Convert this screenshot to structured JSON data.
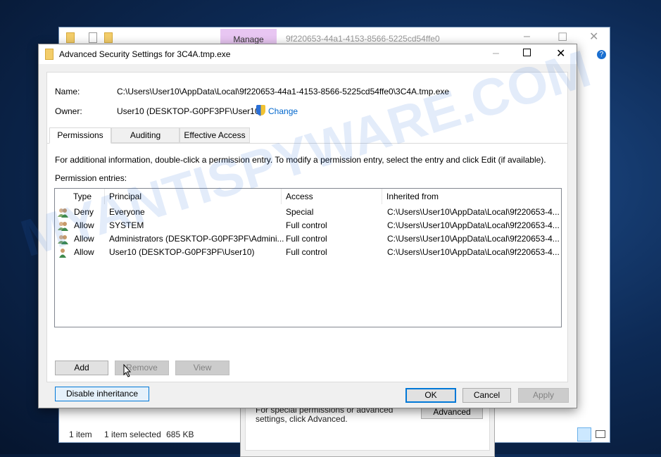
{
  "explorer": {
    "title": "9f220653-44a1-4153-8566-5225cd54ffe0",
    "ribbon_tab": "Manage",
    "status": {
      "items": "1 item",
      "selected": "1 item selected",
      "size": "685 KB"
    }
  },
  "properties": {
    "hint": "For special permissions or advanced settings, click Advanced.",
    "advanced_label": "Advanced"
  },
  "dialog": {
    "title": "Advanced Security Settings for 3C4A.tmp.exe",
    "name_label": "Name:",
    "name_value": "C:\\Users\\User10\\AppData\\Local\\9f220653-44a1-4153-8566-5225cd54ffe0\\3C4A.tmp.exe",
    "owner_label": "Owner:",
    "owner_value": "User10 (DESKTOP-G0PF3PF\\User10)",
    "change_label": "Change",
    "tabs": [
      {
        "label": "Permissions",
        "active": true
      },
      {
        "label": "Auditing"
      },
      {
        "label": "Effective Access"
      }
    ],
    "info": "For additional information, double-click a permission entry. To modify a permission entry, select the entry and click Edit (if available).",
    "entries_label": "Permission entries:",
    "columns": [
      "Type",
      "Principal",
      "Access",
      "Inherited from"
    ],
    "rows": [
      {
        "icon": "group-icon",
        "type": "Deny",
        "principal": "Everyone",
        "access": "Special",
        "inherited": "C:\\Users\\User10\\AppData\\Local\\9f220653-4..."
      },
      {
        "icon": "group-icon",
        "type": "Allow",
        "principal": "SYSTEM",
        "access": "Full control",
        "inherited": "C:\\Users\\User10\\AppData\\Local\\9f220653-4..."
      },
      {
        "icon": "group-icon",
        "type": "Allow",
        "principal": "Administrators (DESKTOP-G0PF3PF\\Admini...",
        "access": "Full control",
        "inherited": "C:\\Users\\User10\\AppData\\Local\\9f220653-4..."
      },
      {
        "icon": "user-icon",
        "type": "Allow",
        "principal": "User10 (DESKTOP-G0PF3PF\\User10)",
        "access": "Full control",
        "inherited": "C:\\Users\\User10\\AppData\\Local\\9f220653-4..."
      }
    ],
    "buttons": {
      "add": "Add",
      "remove": "Remove",
      "view": "View",
      "disable_inheritance": "Disable inheritance",
      "ok": "OK",
      "cancel": "Cancel",
      "apply": "Apply"
    }
  },
  "watermark": "MYANTISPYWARE.COM"
}
